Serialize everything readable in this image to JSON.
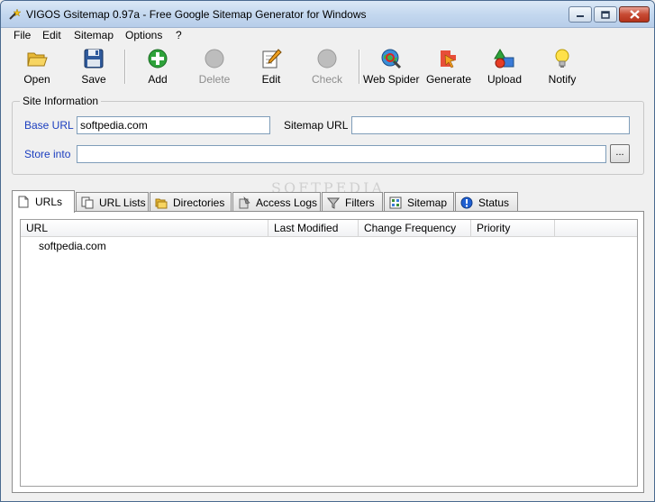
{
  "window": {
    "title": "VIGOS Gsitemap 0.97a - Free Google Sitemap Generator for Windows"
  },
  "menu": [
    "File",
    "Edit",
    "Sitemap",
    "Options",
    "?"
  ],
  "toolbar": {
    "open": "Open",
    "save": "Save",
    "add": "Add",
    "delete": "Delete",
    "edit": "Edit",
    "check": "Check",
    "web_spider": "Web Spider",
    "generate": "Generate",
    "upload": "Upload",
    "notify": "Notify"
  },
  "site_info": {
    "legend": "Site Information",
    "base_url_label": "Base URL",
    "base_url_value": "softpedia.com",
    "sitemap_url_label": "Sitemap URL",
    "sitemap_url_value": "",
    "store_into_label": "Store into",
    "store_into_value": "",
    "browse_label": "..."
  },
  "tabs": [
    "URLs",
    "URL Lists",
    "Directories",
    "Access Logs",
    "Filters",
    "Sitemap",
    "Status"
  ],
  "active_tab": "URLs",
  "list": {
    "columns": [
      "URL",
      "Last Modified",
      "Change Frequency",
      "Priority"
    ],
    "rows": [
      {
        "url": "softpedia.com",
        "last_modified": "",
        "change_frequency": "",
        "priority": ""
      }
    ]
  },
  "watermark": "SOFTPEDIA",
  "colors": {
    "label_blue": "#1b3ebf",
    "titlebar": "#c4d8ef",
    "close_button": "#c74b33"
  }
}
